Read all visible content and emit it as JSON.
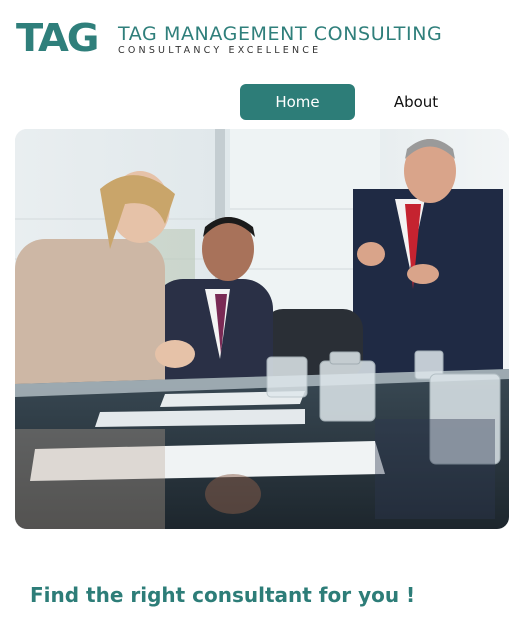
{
  "brand": {
    "logo_mark": "TAG",
    "name": "TAG MANAGEMENT CONSULTING",
    "slogan": "CONSULTANCY EXCELLENCE",
    "color": "#2d7d78"
  },
  "nav": {
    "items": [
      {
        "label": "Home",
        "active": true
      },
      {
        "label": "About",
        "active": false
      }
    ]
  },
  "hero": {
    "icon": "business-meeting-photo"
  },
  "main": {
    "tagline": "Find the right consultant for you !"
  }
}
